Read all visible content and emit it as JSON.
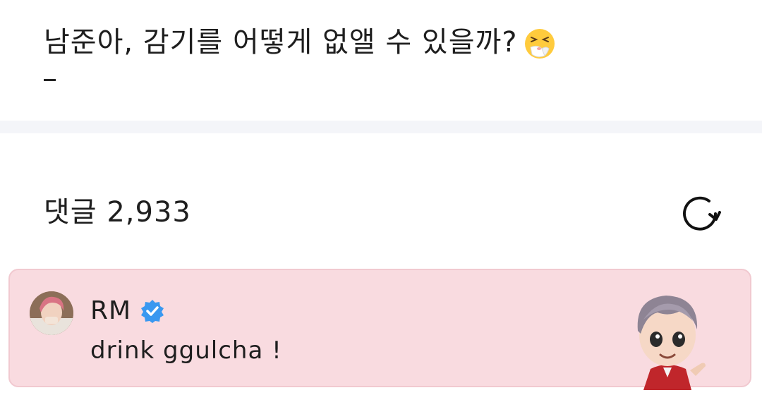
{
  "post": {
    "question": "남준아, 감기를 어떻게 없앨 수 있을까?",
    "emoji_icon": "sneezing-face-icon"
  },
  "comments": {
    "label": "댓글",
    "count": "2,933",
    "refresh_icon": "refresh-icon"
  },
  "featured_comment": {
    "author": "RM",
    "verified_icon": "verified-badge-icon",
    "text": "drink ggulcha !",
    "background": "#f9dbe0",
    "badge_color": "#3a98f0"
  }
}
